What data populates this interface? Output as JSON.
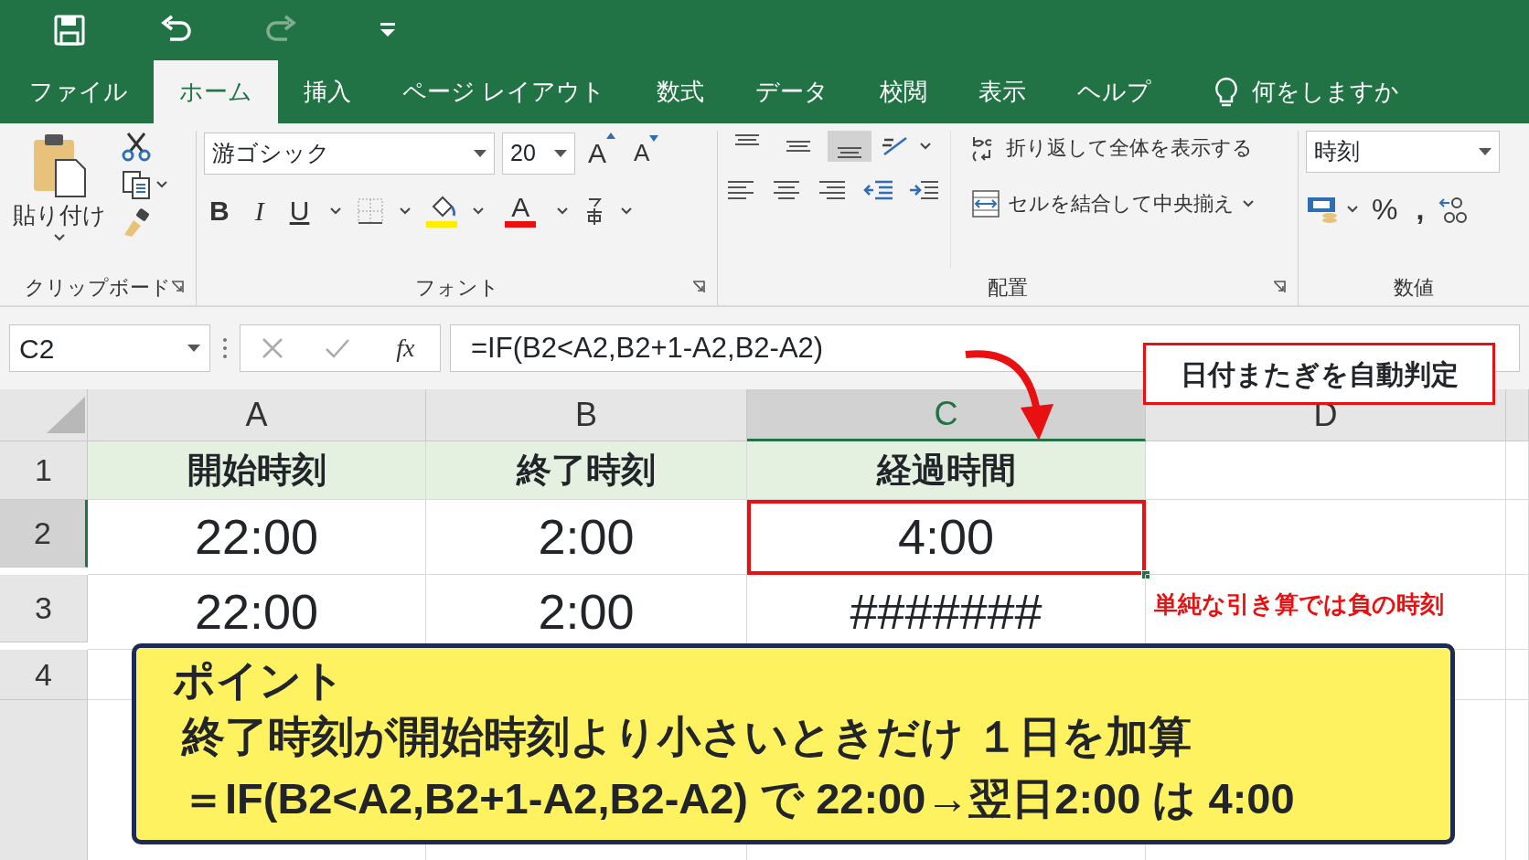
{
  "quick_access": [
    {
      "kind": "save",
      "disabled": false
    },
    {
      "kind": "undo",
      "disabled": false
    },
    {
      "kind": "redo",
      "disabled": true
    },
    {
      "kind": "customize",
      "disabled": false
    }
  ],
  "tabs": [
    {
      "label": "ファイル",
      "selected": false
    },
    {
      "label": "ホーム",
      "selected": true
    },
    {
      "label": "挿入",
      "selected": false
    },
    {
      "label": "ページ レイアウト",
      "selected": false
    },
    {
      "label": "数式",
      "selected": false
    },
    {
      "label": "データ",
      "selected": false
    },
    {
      "label": "校閲",
      "selected": false
    },
    {
      "label": "表示",
      "selected": false
    },
    {
      "label": "ヘルプ",
      "selected": false
    }
  ],
  "tell_me": {
    "label": "何をしますか"
  },
  "ribbon": {
    "clipboard": {
      "label": "クリップボード",
      "paste": "貼り付け"
    },
    "font": {
      "label": "フォント",
      "font_name": "游ゴシック",
      "font_size": "20",
      "grow": "A",
      "shrink": "A",
      "bold": "B",
      "italic": "I",
      "underline": "U",
      "font_color": "A"
    },
    "alignment": {
      "label": "配置",
      "vertical": [
        {
          "kind": "top",
          "selected": false
        },
        {
          "kind": "middle",
          "selected": false
        },
        {
          "kind": "bottom",
          "selected": true
        }
      ],
      "wrap_text": "折り返して全体を表示する",
      "merge": "セルを結合して中央揃え"
    },
    "number": {
      "label": "数値",
      "format": "時刻",
      "percent": "%",
      "comma": ","
    }
  },
  "formula_bar": {
    "name_box": "C2",
    "fx": "fx",
    "formula": "=IF(B2<A2,B2+1-A2,B2-A2)"
  },
  "columns": [
    {
      "label": "A",
      "selected": false
    },
    {
      "label": "B",
      "selected": false
    },
    {
      "label": "C",
      "selected": true
    },
    {
      "label": "D",
      "selected": false
    }
  ],
  "rows": [
    {
      "label": "1",
      "selected": false,
      "kind": "header",
      "cells": [
        {
          "text": "開始時刻",
          "selected": false
        },
        {
          "text": "終了時刻",
          "selected": false
        },
        {
          "text": "経過時間",
          "selected": false
        }
      ]
    },
    {
      "label": "2",
      "selected": true,
      "kind": "value",
      "cells": [
        {
          "text": "22:00",
          "selected": false
        },
        {
          "text": "2:00",
          "selected": false
        },
        {
          "text": "4:00",
          "selected": true
        }
      ]
    },
    {
      "label": "3",
      "selected": false,
      "kind": "value",
      "cells": [
        {
          "text": "22:00",
          "selected": false
        },
        {
          "text": "2:00",
          "selected": false
        },
        {
          "text": "#######",
          "selected": false
        }
      ]
    },
    {
      "label": "4",
      "selected": false
    }
  ],
  "annotations": {
    "callout": "日付またぎを自動判定",
    "note": "単純な引き算では負の時刻",
    "point": {
      "title": "ポイント",
      "lines": [
        "終了時刻が開始時刻より小さいときだけ １日を加算",
        "＝IF(B2<A2,B2+1-A2,B2-A2) で 22:00→翌日2:00 は 4:00"
      ]
    }
  }
}
